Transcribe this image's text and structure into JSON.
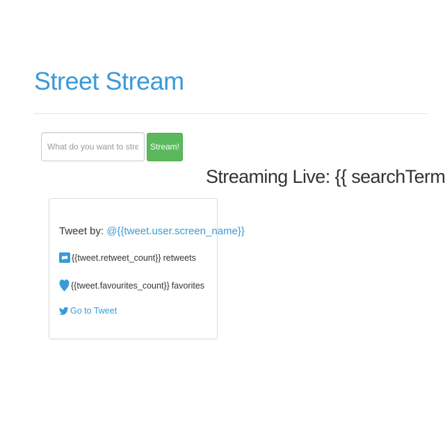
{
  "header": {
    "title": "Street Stream"
  },
  "stream_form": {
    "placeholder": "What do you want to stream?",
    "value": "",
    "button_label": "Stream!"
  },
  "status": {
    "streaming_label": "Streaming Live: {{ searchTerm }}"
  },
  "tweet_card": {
    "tweet_by_label": "Tweet by:",
    "screen_name": "@{{tweet.user.screen_name}}",
    "retweet_count": "{{tweet.retweet_count}}",
    "retweet_label": "retweets",
    "favourites_count": "{{tweet.favourites_count}}",
    "favourite_label": "favorites",
    "goto_label": "Go to Tweet",
    "icons": {
      "retweet": "retweet-icon",
      "favorite": "heart-icon",
      "twitter": "twitter-bird-icon"
    }
  },
  "colors": {
    "brand_blue": "#3a9ad9",
    "link_blue": "#3a9ad9",
    "success_green": "#5cb85c",
    "text_dark": "#333333",
    "divider": "#e5e5e5"
  }
}
